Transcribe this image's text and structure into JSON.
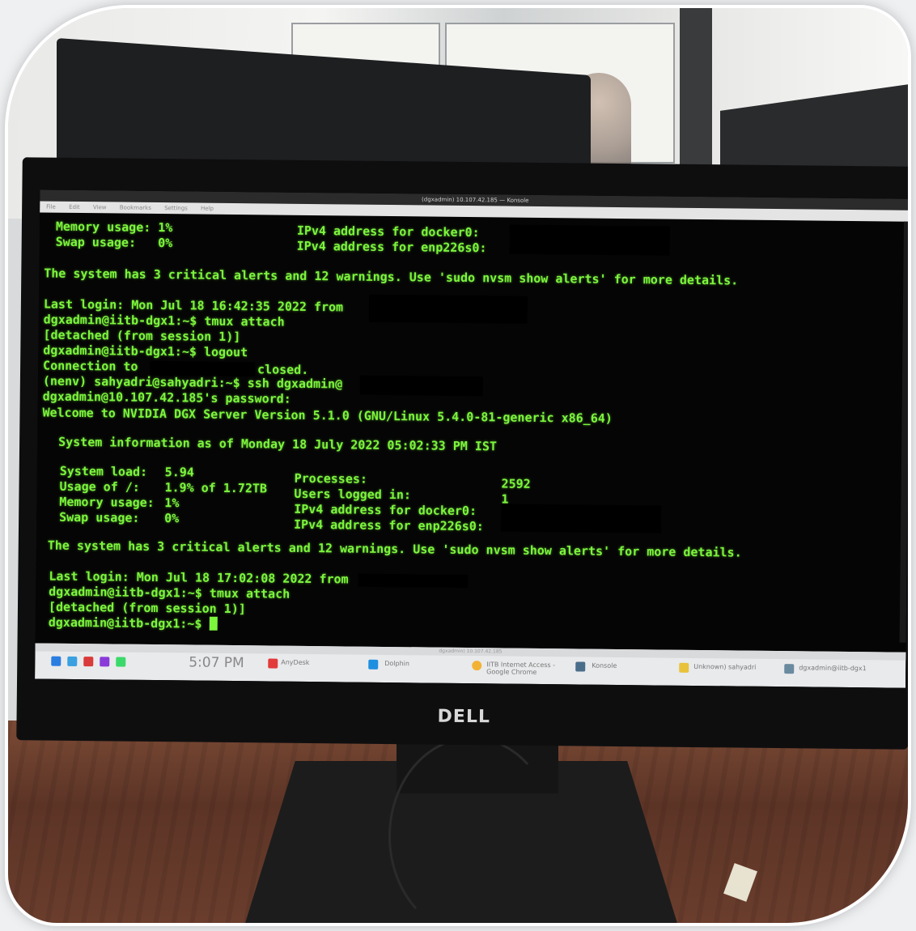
{
  "window": {
    "title": "(dgxadmin) 10.107.42.185 — Konsole",
    "menu": [
      "File",
      "Edit",
      "View",
      "Bookmarks",
      "Settings",
      "Help"
    ]
  },
  "terminal": {
    "prev_memory": "Memory usage: 1%",
    "prev_swap": "Swap usage:   0%",
    "prev_ipv4_docker": "IPv4 address for docker0:",
    "prev_ipv4_enp": "IPv4 address for enp226s0:",
    "alert1": "The system has 3 critical alerts and 12 warnings. Use 'sudo nvsm show alerts' for more details.",
    "last_login1": "Last login: Mon Jul 18 16:42:35 2022 from",
    "cmd_tmux1": "dgxadmin@iitb-dgx1:~$ tmux attach",
    "detached1": "[detached (from session 1)]",
    "cmd_logout": "dgxadmin@iitb-dgx1:~$ logout",
    "conn_prefix": "Connection to",
    "conn_suffix": "closed.",
    "ssh_cmd": "(nenv) sahyadri@sahyadri:~$ ssh dgxadmin@",
    "password": "dgxadmin@10.107.42.185's password:",
    "welcome": "Welcome to NVIDIA DGX Server Version 5.1.0 (GNU/Linux 5.4.0-81-generic x86_64)",
    "sysinfo": "System information as of Monday 18 July 2022 05:02:33 PM IST",
    "load_label": "System load:",
    "load_value": "5.94",
    "usage_label": "Usage of /:",
    "usage_value": "1.9% of 1.72TB",
    "mem_label": "Memory usage:",
    "mem_value": "1%",
    "swap_label": "Swap usage:",
    "swap_value": "0%",
    "processes_label": "Processes:",
    "processes_value": "2592",
    "users_label": "Users logged in:",
    "users_value": "1",
    "ipv4_docker": "IPv4 address for docker0:",
    "ipv4_enp": "IPv4 address for enp226s0:",
    "alert2": "The system has 3 critical alerts and 12 warnings. Use 'sudo nvsm show alerts' for more details.",
    "last_login2": "Last login: Mon Jul 18 17:02:08 2022 from",
    "cmd_tmux2": "dgxadmin@iitb-dgx1:~$ tmux attach",
    "detached2": "[detached (from session 1)]",
    "prompt": "dgxadmin@iitb-dgx1:~$ "
  },
  "taskbar": {
    "strip": "dgxadmin) 10.107.42.185",
    "clock": "5:07 PM",
    "items": [
      "AnyDesk",
      "Dolphin",
      "IITB Internet Access - Google Chrome",
      "Konsole",
      "Unknown) sahyadri",
      "dgxadmin@iitb-dgx1"
    ]
  },
  "brand": {
    "logo": "DELL"
  },
  "colors": {
    "terminal_text": "#7cf53d",
    "terminal_bg": "#050505",
    "bezel": "#0e0e0f"
  }
}
